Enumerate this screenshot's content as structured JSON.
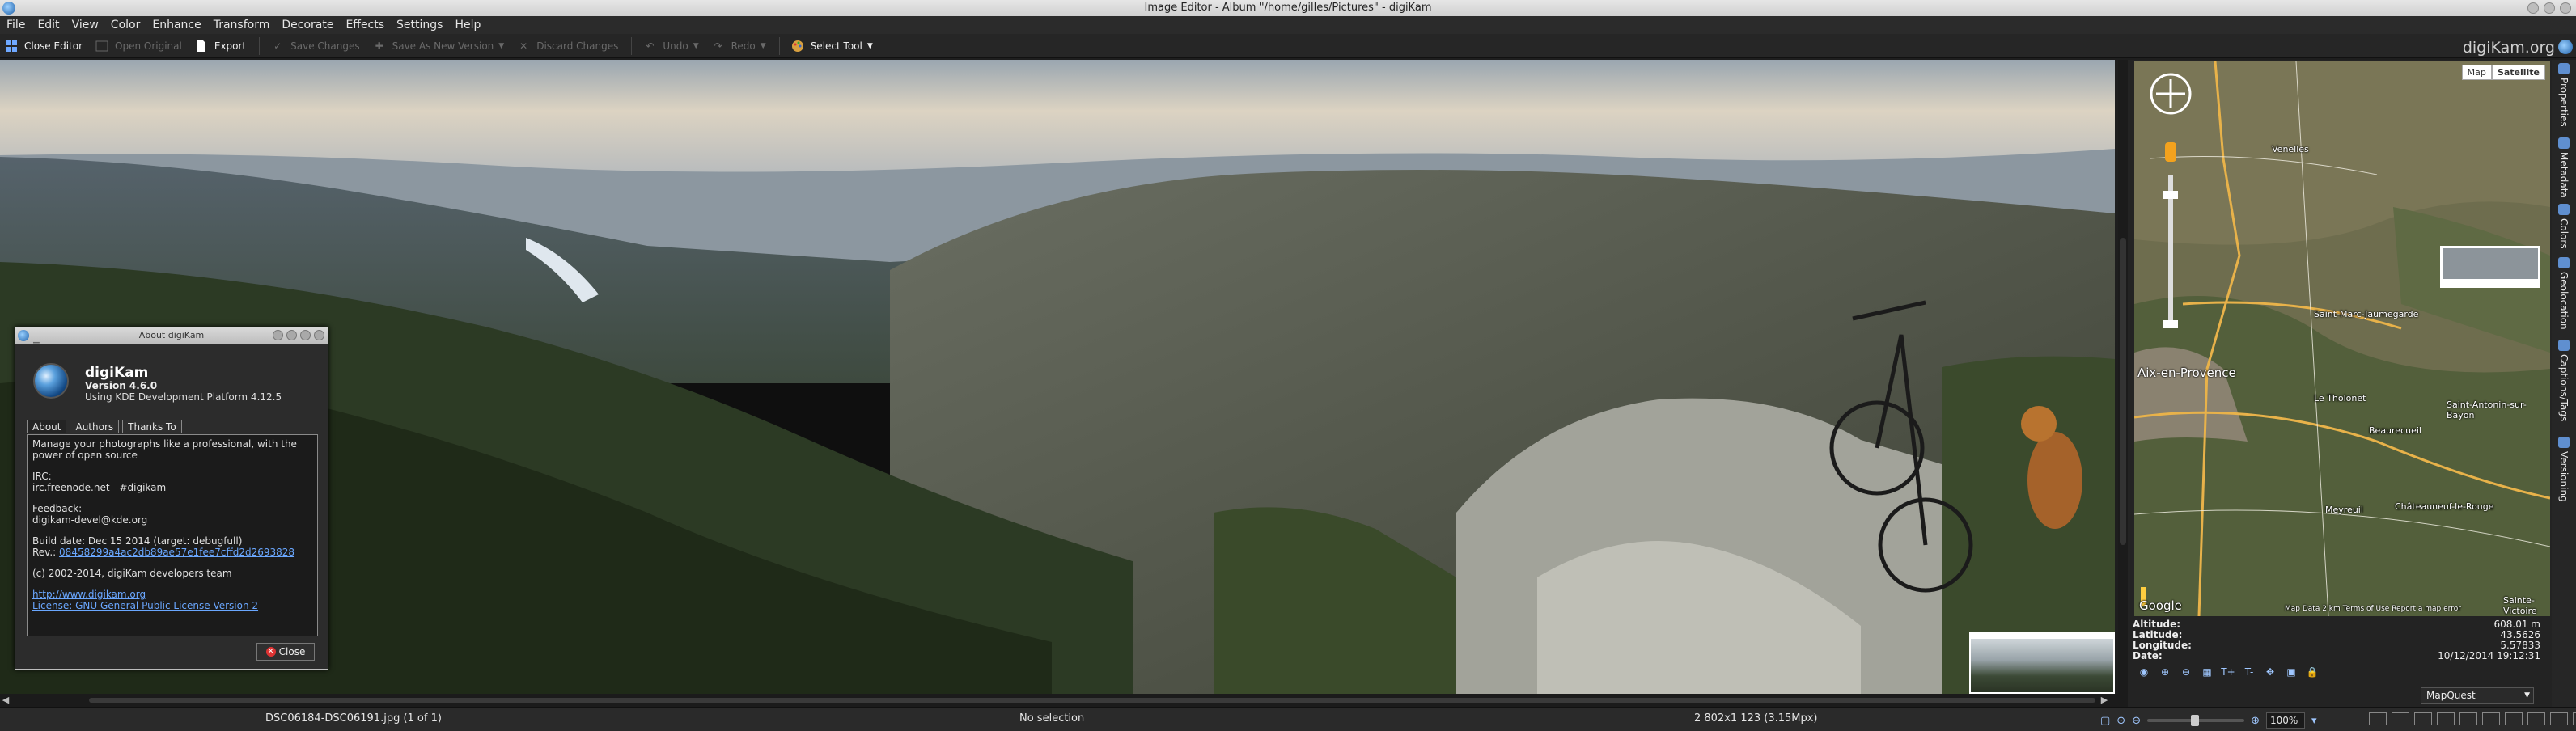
{
  "window": {
    "title": "Image Editor - Album \"/home/gilles/Pictures\" - digiKam"
  },
  "menu": [
    "File",
    "Edit",
    "View",
    "Color",
    "Enhance",
    "Transform",
    "Decorate",
    "Effects",
    "Settings",
    "Help"
  ],
  "toolbar": {
    "close_editor": "Close Editor",
    "open_original": "Open Original",
    "export": "Export",
    "save_changes": "Save Changes",
    "save_as_new_version": "Save As New Version",
    "discard_changes": "Discard Changes",
    "undo": "Undo",
    "redo": "Redo",
    "select_tool": "Select Tool",
    "brand": "digiKam.org"
  },
  "about": {
    "dialog_title": "About digiKam",
    "app_name": "digiKam",
    "version": "Version 4.6.0",
    "platform": "Using KDE Development Platform 4.12.5",
    "tabs": [
      "About",
      "Authors",
      "Thanks To"
    ],
    "description": "Manage your photographs like a professional, with the power of open source",
    "irc_label": "IRC:",
    "irc_value": "irc.freenode.net - #digikam",
    "feedback_label": "Feedback:",
    "feedback_value": "digikam-devel@kde.org",
    "build_date": "Build date: Dec 15 2014 (target: debugfull)",
    "rev_label": "Rev.:",
    "rev_value": "08458299a4ac2db89ae57e1fee7cffd2d2693828",
    "copyright": "(c) 2002-2014, digiKam developers team",
    "website": "http://www.digikam.org",
    "license": "License: GNU General Public License Version 2",
    "close_label": "Close"
  },
  "map": {
    "type_map": "Map",
    "type_satellite": "Satellite",
    "places": [
      "Venelles",
      "Aix-en-Provence",
      "Saint-Marc-Jaumegarde",
      "Le Tholonet",
      "Beaurecueil",
      "Saint-Antonin-sur-Bayon",
      "Meyreuil",
      "Châteauneuf-le-Rouge",
      "Sainte-Victoire"
    ],
    "google": "Google",
    "attribution": "Map Data  2 km  Terms of Use  Report a map error",
    "provider": "MapQuest"
  },
  "geolocation": {
    "altitude_label": "Altitude:",
    "altitude_value": "608.01 m",
    "latitude_label": "Latitude:",
    "latitude_value": "43.5626",
    "longitude_label": "Longitude:",
    "longitude_value": "5.57833",
    "date_label": "Date:",
    "date_value": "10/12/2014 19:12:31"
  },
  "sidetabs": [
    "Properties",
    "Metadata",
    "Colors",
    "Geolocation",
    "Captions/Tags",
    "Versioning"
  ],
  "status": {
    "filename": "DSC06184-DSC06191.jpg (1 of 1)",
    "selection": "No selection",
    "dimensions": "2 802x1 123 (3.15Mpx)",
    "zoom": "100%"
  }
}
